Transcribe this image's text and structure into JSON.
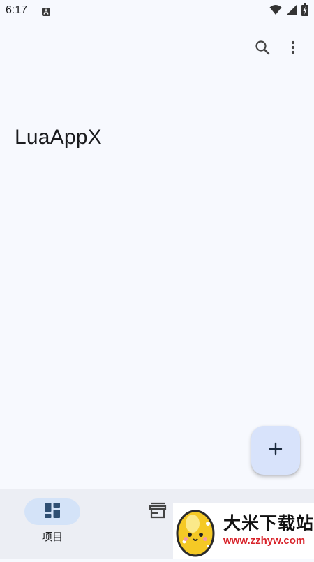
{
  "status_bar": {
    "time": "6:17",
    "icons": [
      "a-notification-icon",
      "wifi-icon",
      "signal-icon",
      "battery-icon"
    ]
  },
  "toolbar": {
    "actions": [
      "search-icon",
      "more-vert-icon"
    ]
  },
  "main": {
    "title": "LuaAppX"
  },
  "fab": {
    "icon": "plus-icon"
  },
  "bottom_nav": {
    "items": [
      {
        "label": "项目",
        "icon": "dashboard-icon",
        "selected": true
      },
      {
        "label": "",
        "icon": "storefront-icon",
        "selected": false
      }
    ]
  },
  "watermark": {
    "brand": "大米下载站",
    "url": "www.zzhyw.com"
  },
  "colors": {
    "background": "#f7f9fe",
    "nav_background": "#eceef4",
    "selected_pill": "#d4e3f8",
    "fab": "#d8e3fb",
    "primary_icon": "#2f4f73",
    "watermark_url": "#d8232a"
  }
}
